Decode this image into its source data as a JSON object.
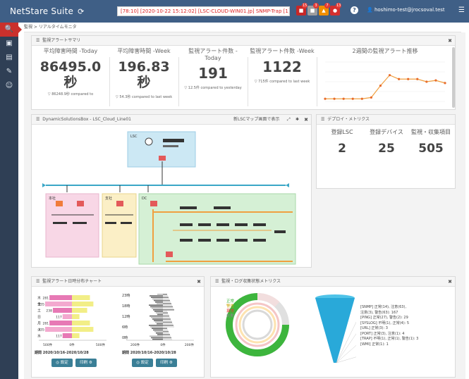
{
  "topbar": {
    "brand": "NetStare Suite",
    "alert_text": "[78:10] [2020-10-22 15:12:02] [LSC-CLOUD-WIN01.jp] SNMP-Trap [1] [ 156 ]",
    "badges": [
      "15",
      "3",
      "7",
      "13"
    ],
    "user": "hoshimo-test@jrocsoval.test"
  },
  "sidebar": {
    "items": [
      "search-icon",
      "dashboard-icon",
      "bookmark-icon",
      "wrench-icon",
      "users-icon"
    ]
  },
  "breadcrumb": "監視 > リアルタイムモニタ",
  "summary": {
    "title": "監視アラートサマリ",
    "stats": [
      {
        "label": "平均障害時間 -Today",
        "value": "86495.0秒",
        "sub": "▽ 86248.9秒 compared to"
      },
      {
        "label": "平均障害時間 -Week",
        "value": "196.83秒",
        "sub": "▽ 54.3秒 compared to last week"
      },
      {
        "label": "監視アラート件数 -Today",
        "value": "191",
        "sub": "▽ 12.5件 compared to yesterday"
      },
      {
        "label": "監視アラート件数 -Week",
        "value": "1122",
        "sub": "▽ 715件 compared to last week"
      }
    ],
    "trend_label": "2週間の監視アラート推移"
  },
  "chart_data": {
    "type": "line",
    "title": "2週間の監視アラート推移",
    "x": [
      1,
      2,
      3,
      4,
      5,
      6,
      7,
      8,
      9,
      10,
      11,
      12,
      13,
      14
    ],
    "values": [
      2,
      2,
      2,
      2,
      2,
      3,
      12,
      20,
      17,
      17,
      17,
      15,
      16,
      14
    ],
    "ylim": [
      0,
      30
    ],
    "grid": true
  },
  "topology": {
    "title": "DynamicSolutionsBox - LSC_Cloud_Line01",
    "toolbar": "新LSCマップ画面で表示",
    "areas": [
      "LSC",
      "本社",
      "支社",
      "DC"
    ]
  },
  "deploy": {
    "title": "デプロイ・メトリクス",
    "metrics": [
      {
        "label": "登録LSC",
        "value": "2"
      },
      {
        "label": "登録デバイス",
        "value": "25"
      },
      {
        "label": "監視・収集項目",
        "value": "505"
      }
    ]
  },
  "alerts_chart": {
    "title": "監視アラート日時分布チャート",
    "left_caption": "期間 2020/10/16-2020/10/28",
    "right_caption": "期間 2020/10/16-2020/10/28",
    "left_axis": [
      "500件",
      "0件",
      "500件"
    ],
    "right_axis": [
      "200件",
      "0件",
      "200件"
    ],
    "left_rows": [
      {
        "label": "木",
        "value": "281"
      },
      {
        "label": "金",
        "value": "335"
      },
      {
        "label": "土",
        "value": "238"
      },
      {
        "label": "日",
        "value": "117"
      },
      {
        "label": "月",
        "value": "281"
      },
      {
        "label": "火",
        "value": "335"
      },
      {
        "label": "水",
        "value": "117"
      }
    ],
    "right_rows": [
      "23時",
      "18時",
      "12時",
      "6時",
      "0時"
    ],
    "buttons": [
      "◎ 設定",
      "印刷 ⚙",
      "◎ 設定",
      "印刷 ⚙"
    ]
  },
  "metrics_panel": {
    "title": "監視・ログ収集状態メトリクス",
    "gauge_labels": [
      "正常",
      "警告",
      "異常",
      "失敗"
    ],
    "funnel_lines": [
      "[SNMP] 正常(14), 注意(63),",
      "注意(3), 警告(63): 167",
      "[PING] 正常(27), 警告(2): 29",
      "[SYSLOG] 不明(1), 正常(4): 5",
      "[URL] 正常(3): 3",
      "[PORT] 正常(3), 注意(1): 4",
      "[TRAP] 不明(1), 正常(1), 警告(1): 3",
      "[WMI] 正常(1): 1"
    ]
  }
}
